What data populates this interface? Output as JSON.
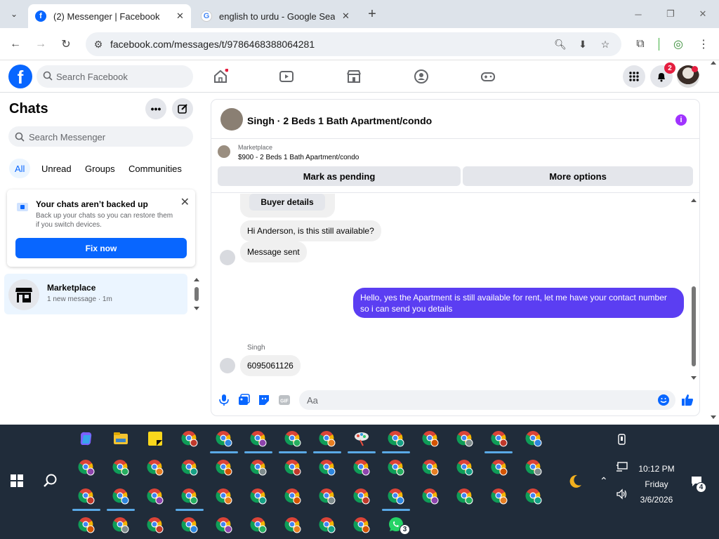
{
  "browser": {
    "tabs": [
      {
        "title": "(2) Messenger | Facebook",
        "active": true
      },
      {
        "title": "english to urdu - Google Search",
        "active": false
      }
    ],
    "url": "facebook.com/messages/t/9786468388064281"
  },
  "facebook": {
    "search_placeholder": "Search Facebook",
    "notification_count": "2"
  },
  "sidebar": {
    "title": "Chats",
    "search_placeholder": "Search Messenger",
    "filters": [
      "All",
      "Unread",
      "Groups",
      "Communities"
    ],
    "backup_title": "Your chats aren’t backed up",
    "backup_desc": "Back up your chats so you can restore them if you switch devices.",
    "fix_label": "Fix now",
    "chat_name": "Marketplace",
    "chat_sub": "1 new message · 1m"
  },
  "conversation": {
    "title": "Singh · 2 Beds 1 Bath Apartment/condo",
    "marketplace_label": "Marketplace",
    "listing": "$900 - 2 Beds 1 Bath Apartment/condo",
    "mark_pending": "Mark as pending",
    "more_options": "More options",
    "buyer_details": "Buyer details",
    "msg1": "Hi Anderson, is this still available?",
    "msg2": "Message sent",
    "outgoing_line1": "Hello, yes the Apartment is still available for rent, let me have your contact number",
    "outgoing_line2": "so i can send you details",
    "sender_name": "Singh",
    "msg3": "6095061126",
    "composer_placeholder": "Aa"
  },
  "taskbar": {
    "time": "10:12 PM",
    "day": "Friday",
    "date": "3/6/2026",
    "whatsapp_badge": "3",
    "notif_badge": "4"
  }
}
